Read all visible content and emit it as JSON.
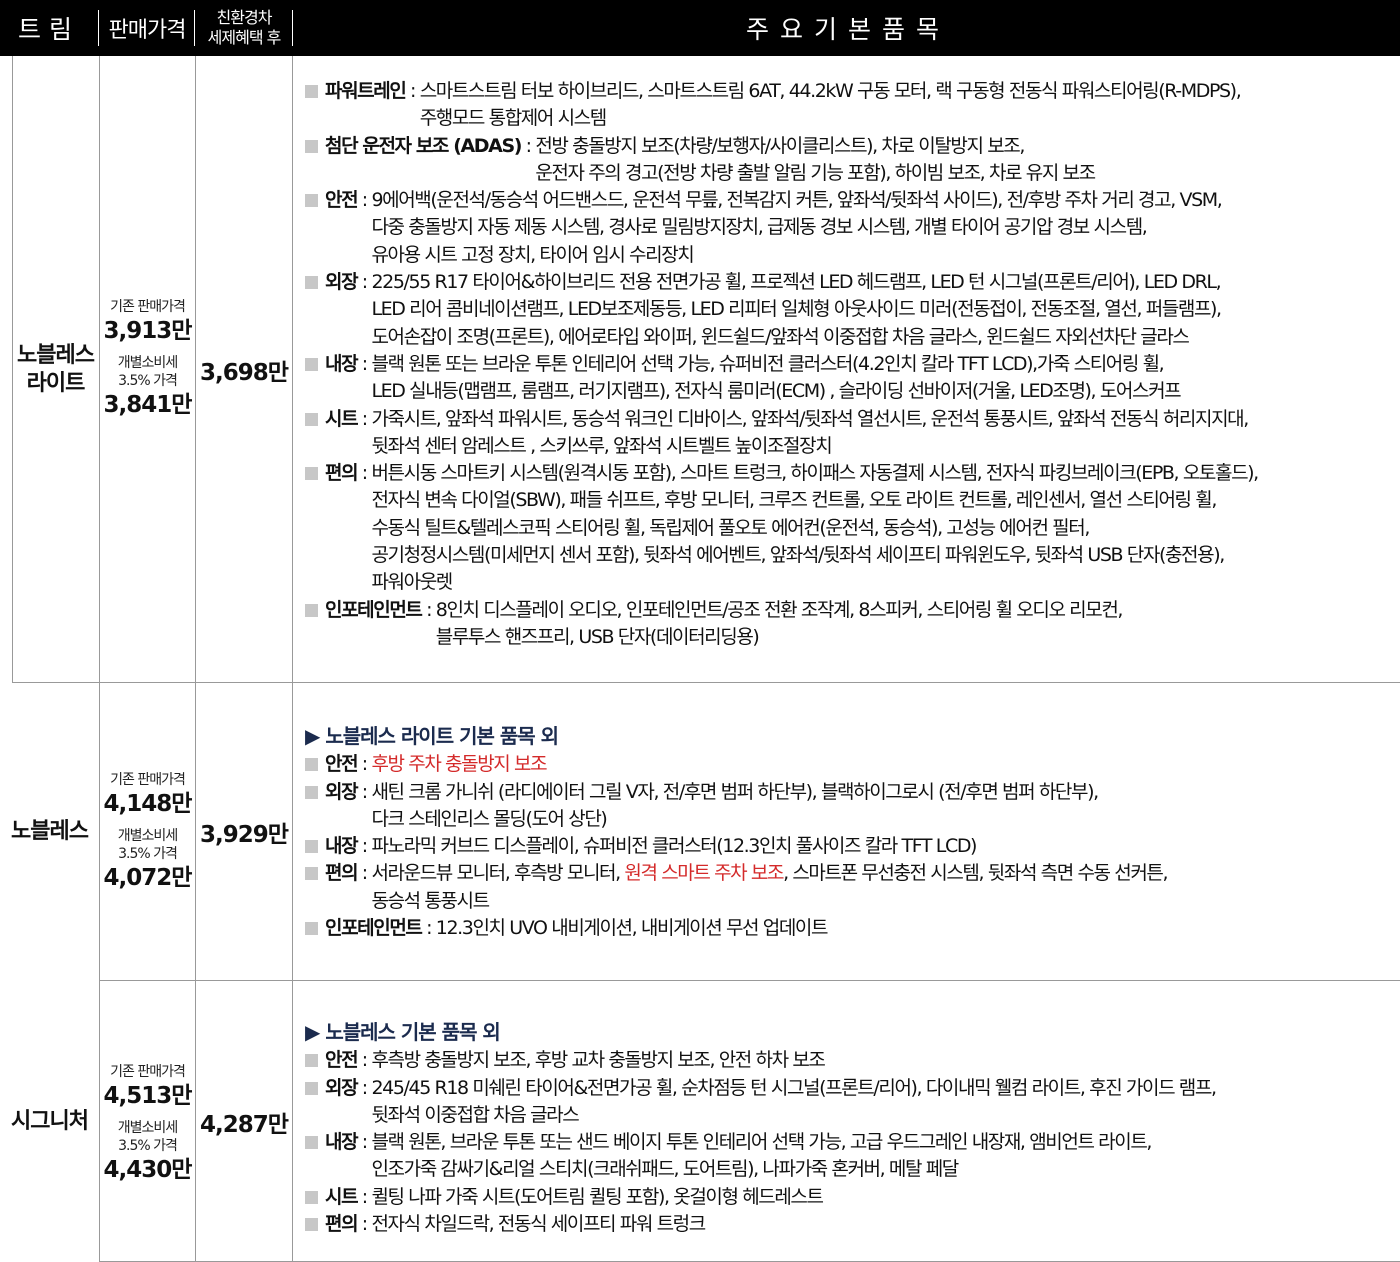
{
  "header": {
    "trim": "트림",
    "price": "판매가격",
    "eco_line1": "친환경차",
    "eco_line2": "세제혜택 후",
    "main": "주요기본품목"
  },
  "labels": {
    "base_price": "기존 판매가격",
    "tax_line1": "개별소비세",
    "tax_line2": "3.5% 가격"
  },
  "colors": {
    "header_bg": "#000000",
    "highlight": "#d42a2a",
    "bullet": "#c7c7c7",
    "subhead": "#1b2b4e"
  },
  "trims": [
    {
      "name_line1": "노블레스",
      "name_line2": "라이트",
      "base_price": "3,913만",
      "tax_price": "3,841만",
      "eco_price": "3,698만",
      "headline": "",
      "features": [
        {
          "category": "파워트레인",
          "sep": " : ",
          "lines": [
            [
              {
                "t": "스마트스트림 터보 하이브리드, 스마트스트림 6AT, 44.2kW 구동 모터, 랙 구동형 전동식 파워스티어링(R-MDPS),"
              }
            ],
            [
              {
                "t": "주행모드 통합제어 시스템"
              }
            ]
          ]
        },
        {
          "category": "첨단 운전자 보조 (ADAS)",
          "sep": " : ",
          "lines": [
            [
              {
                "t": "전방 충돌방지 보조(차량/보행자/사이클리스트), 차로 이탈방지 보조,"
              }
            ],
            [
              {
                "t": "운전자 주의 경고(전방 차량 출발 알림 기능 포함), 하이빔 보조, 차로 유지 보조"
              }
            ]
          ]
        },
        {
          "category": "안전",
          "sep": " : ",
          "lines": [
            [
              {
                "t": "9에어백(운전석/동승석 어드밴스드, 운전석 무릎, 전복감지 커튼, 앞좌석/뒷좌석 사이드), 전/후방 주차 거리 경고, VSM,"
              }
            ],
            [
              {
                "t": "다중 충돌방지 자동 제동 시스템, 경사로 밀림방지장치, 급제동 경보 시스템, 개별 타이어 공기압 경보 시스템,"
              }
            ],
            [
              {
                "t": "유아용 시트 고정 장치, 타이어 임시 수리장치"
              }
            ]
          ]
        },
        {
          "category": "외장",
          "sep": " : ",
          "lines": [
            [
              {
                "t": "225/55 R17 타이어&하이브리드 전용 전면가공 휠, 프로젝션 LED 헤드램프, LED 턴 시그널(프론트/리어), LED DRL,"
              }
            ],
            [
              {
                "t": "LED 리어 콤비네이션램프, LED보조제동등, LED 리피터 일체형 아웃사이드 미러(전동접이, 전동조절, 열선, 퍼들램프),"
              }
            ],
            [
              {
                "t": "도어손잡이 조명(프론트), 에어로타입 와이퍼, 윈드쉴드/앞좌석 이중접합 차음 글라스, 윈드쉴드 자외선차단 글라스"
              }
            ]
          ]
        },
        {
          "category": "내장",
          "sep": " : ",
          "lines": [
            [
              {
                "t": "블랙 원톤 또는 브라운 투톤 인테리어 선택 가능, 슈퍼비전 클러스터(4.2인치 칼라 TFT LCD),가죽 스티어링 휠,"
              }
            ],
            [
              {
                "t": "LED 실내등(맵램프, 룸램프, 러기지램프), 전자식 룸미러(ECM) , 슬라이딩 선바이저(거울, LED조명), 도어스커프"
              }
            ]
          ]
        },
        {
          "category": "시트",
          "sep": " : ",
          "lines": [
            [
              {
                "t": "가죽시트, 앞좌석 파워시트, 동승석 워크인 디바이스, 앞좌석/뒷좌석 열선시트, 운전석 통풍시트, 앞좌석 전동식 허리지지대,"
              }
            ],
            [
              {
                "t": "뒷좌석 센터 암레스트 , 스키쓰루, 앞좌석 시트벨트 높이조절장치"
              }
            ]
          ]
        },
        {
          "category": "편의",
          "sep": " : ",
          "lines": [
            [
              {
                "t": "버튼시동 스마트키 시스템(원격시동 포함), 스마트 트렁크, 하이패스 자동결제 시스템, 전자식 파킹브레이크(EPB, 오토홀드),"
              }
            ],
            [
              {
                "t": "전자식 변속 다이얼(SBW), 패들 쉬프트, 후방 모니터, 크루즈 컨트롤, 오토 라이트 컨트롤, 레인센서, 열선 스티어링 휠,"
              }
            ],
            [
              {
                "t": "수동식 틸트&텔레스코픽 스티어링 휠, 독립제어 풀오토 에어컨(운전석, 동승석), 고성능 에어컨 필터,"
              }
            ],
            [
              {
                "t": "공기청정시스템(미세먼지 센서 포함), 뒷좌석 에어벤트, 앞좌석/뒷좌석 세이프티 파워윈도우, 뒷좌석 USB 단자(충전용),"
              }
            ],
            [
              {
                "t": "파워아웃렛"
              }
            ]
          ]
        },
        {
          "category": "인포테인먼트",
          "sep": " : ",
          "lines": [
            [
              {
                "t": "8인치 디스플레이 오디오, 인포테인먼트/공조 전환 조작계, 8스피커, 스티어링 휠 오디오 리모컨,"
              }
            ],
            [
              {
                "t": "블루투스 핸즈프리, USB 단자(데이터리딩용)"
              }
            ]
          ]
        }
      ]
    },
    {
      "name_line1": "노블레스",
      "name_line2": "",
      "base_price": "4,148만",
      "tax_price": "4,072만",
      "eco_price": "3,929만",
      "headline": "▶ 노블레스 라이트 기본 품목 외",
      "features": [
        {
          "category": "안전",
          "sep": " : ",
          "lines": [
            [
              {
                "t": "후방 주차 충돌방지 보조",
                "red": true
              }
            ]
          ]
        },
        {
          "category": "외장",
          "sep": " : ",
          "lines": [
            [
              {
                "t": "새틴 크롬 가니쉬 (라디에이터 그릴 V자, 전/후면 범퍼 하단부), 블랙하이그로시 (전/후면 범퍼 하단부),"
              }
            ],
            [
              {
                "t": "다크 스테인리스 몰딩(도어 상단)"
              }
            ]
          ]
        },
        {
          "category": "내장",
          "sep": " : ",
          "lines": [
            [
              {
                "t": "파노라믹 커브드 디스플레이, 슈퍼비전 클러스터(12.3인치 풀사이즈 칼라 TFT LCD)"
              }
            ]
          ]
        },
        {
          "category": "편의",
          "sep": " : ",
          "lines": [
            [
              {
                "t": "서라운드뷰 모니터, 후측방 모니터, "
              },
              {
                "t": "원격 스마트 주차 보조",
                "red": true
              },
              {
                "t": ", 스마트폰 무선충전 시스템, 뒷좌석 측면 수동 선커튼,"
              }
            ],
            [
              {
                "t": "동승석 통풍시트"
              }
            ]
          ]
        },
        {
          "category": "인포테인먼트",
          "sep": " : ",
          "lines": [
            [
              {
                "t": "12.3인치 UVO 내비게이션, 내비게이션 무선 업데이트"
              }
            ]
          ]
        }
      ]
    },
    {
      "name_line1": "시그니처",
      "name_line2": "",
      "base_price": "4,513만",
      "tax_price": "4,430만",
      "eco_price": "4,287만",
      "headline": "▶ 노블레스 기본 품목 외",
      "features": [
        {
          "category": "안전",
          "sep": " : ",
          "lines": [
            [
              {
                "t": "후측방 충돌방지 보조, 후방 교차 충돌방지 보조, 안전 하차 보조"
              }
            ]
          ]
        },
        {
          "category": "외장",
          "sep": " : ",
          "lines": [
            [
              {
                "t": "245/45 R18 미쉐린 타이어&전면가공 휠, 순차점등 턴 시그널(프론트/리어), 다이내믹 웰컴 라이트, 후진 가이드 램프,"
              }
            ],
            [
              {
                "t": "뒷좌석 이중접합 차음 글라스"
              }
            ]
          ]
        },
        {
          "category": "내장",
          "sep": " : ",
          "lines": [
            [
              {
                "t": "블랙 원톤, 브라운 투톤 또는 샌드 베이지 투톤 인테리어 선택 가능, 고급 우드그레인 내장재, 앰비언트 라이트,"
              }
            ],
            [
              {
                "t": "인조가죽 감싸기&리얼 스티치(크래쉬패드, 도어트림), 나파가죽 혼커버, 메탈 페달"
              }
            ]
          ]
        },
        {
          "category": "시트",
          "sep": " : ",
          "lines": [
            [
              {
                "t": "퀼팅 나파 가죽 시트(도어트림 퀼팅 포함), 옷걸이형 헤드레스트"
              }
            ]
          ]
        },
        {
          "category": "편의",
          "sep": " : ",
          "lines": [
            [
              {
                "t": "전자식 차일드락, 전동식 세이프티 파워 트렁크"
              }
            ]
          ]
        }
      ]
    }
  ]
}
